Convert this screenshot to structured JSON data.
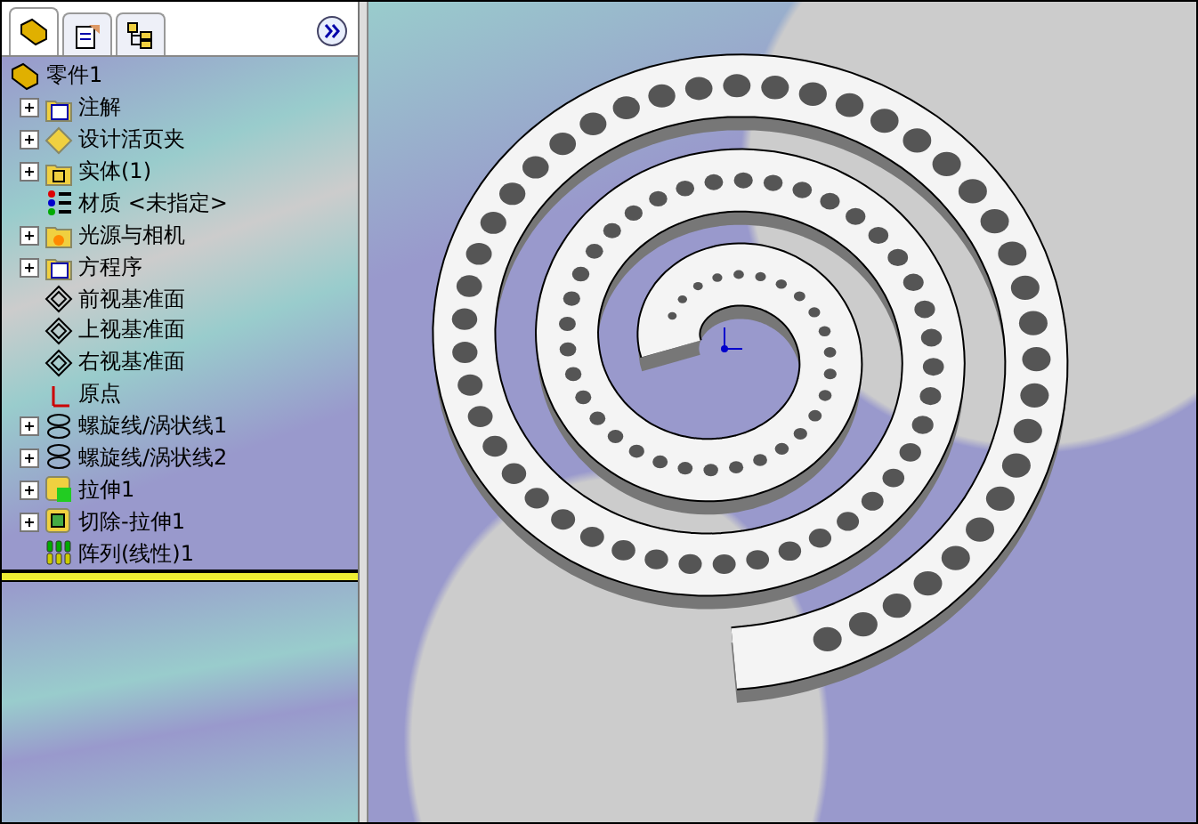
{
  "feature_manager": {
    "tabs": [
      {
        "kind": "part",
        "selected": true
      },
      {
        "kind": "property",
        "selected": false
      },
      {
        "kind": "config",
        "selected": false
      }
    ],
    "root": {
      "label": "零件1"
    },
    "items": [
      {
        "label": "注解",
        "kind": "annotation",
        "collapsible": true
      },
      {
        "label": "设计活页夹",
        "kind": "binder",
        "collapsible": true
      },
      {
        "label": "实体(1)",
        "kind": "solid",
        "collapsible": true
      },
      {
        "label": "材质 <未指定>",
        "kind": "material",
        "collapsible": false
      },
      {
        "label": "光源与相机",
        "kind": "light",
        "collapsible": true
      },
      {
        "label": "方程序",
        "kind": "equation",
        "collapsible": true
      },
      {
        "label": "前视基准面",
        "kind": "plane",
        "collapsible": false
      },
      {
        "label": "上视基准面",
        "kind": "plane",
        "collapsible": false
      },
      {
        "label": "右视基准面",
        "kind": "plane",
        "collapsible": false
      },
      {
        "label": "原点",
        "kind": "origin",
        "collapsible": false
      },
      {
        "label": "螺旋线/涡状线1",
        "kind": "helix",
        "collapsible": true
      },
      {
        "label": "螺旋线/涡状线2",
        "kind": "helix",
        "collapsible": true
      },
      {
        "label": "拉伸1",
        "kind": "extrude",
        "collapsible": true
      },
      {
        "label": "切除-拉伸1",
        "kind": "cut",
        "collapsible": true
      },
      {
        "label": "阵列(线性)1",
        "kind": "pattern",
        "collapsible": false
      }
    ]
  }
}
